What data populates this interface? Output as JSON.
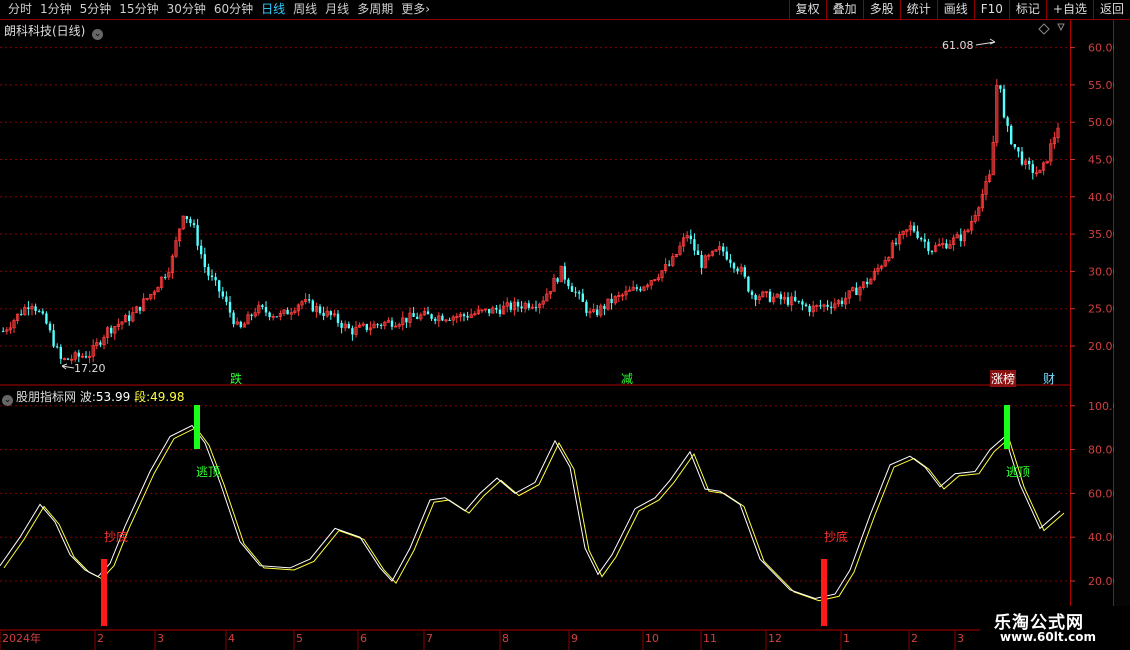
{
  "toolbar": {
    "periods": [
      "分时",
      "1分钟",
      "5分钟",
      "15分钟",
      "30分钟",
      "60分钟",
      "日线",
      "周线",
      "月线",
      "多周期",
      "更多"
    ],
    "active_period": "日线",
    "more_arrow": "›",
    "actions": [
      "复权",
      "叠加",
      "多股",
      "统计",
      "画线",
      "F10",
      "标记",
      "+自选",
      "返回"
    ]
  },
  "main_panel": {
    "title": "朗科科技(日线)",
    "high_marker": "61.08",
    "low_marker": "17.20",
    "y_ticks": [
      "60.00",
      "55.00",
      "50.00",
      "45.00",
      "40.00",
      "35.00",
      "30.00",
      "25.00",
      "20.00"
    ],
    "events": [
      "跌",
      "减",
      "涨榜",
      "财"
    ]
  },
  "indicator_panel": {
    "name": "股朋指标网",
    "wave_label": "波:",
    "wave_value": "53.99",
    "seg_label": "段:",
    "seg_value": "49.98",
    "y_ticks": [
      "100.0",
      "80.00",
      "60.00",
      "40.00",
      "20.00"
    ],
    "signals": {
      "bottom": "抄底",
      "top": "逃顶"
    }
  },
  "x_axis": [
    "2024年",
    "2",
    "3",
    "4",
    "5",
    "6",
    "7",
    "8",
    "9",
    "10",
    "11",
    "12",
    "1",
    "2",
    "3"
  ],
  "watermark": {
    "line1": "乐淘公式网",
    "line2": "www.60lt.com"
  },
  "colors": {
    "up": "#ff3c3c",
    "down": "#54ffff",
    "grid": "#8b0000",
    "wave": "#ffffff",
    "seg": "#ffff40",
    "bottom_bar": "#ff1a1a",
    "top_bar": "#1aff1a"
  }
}
